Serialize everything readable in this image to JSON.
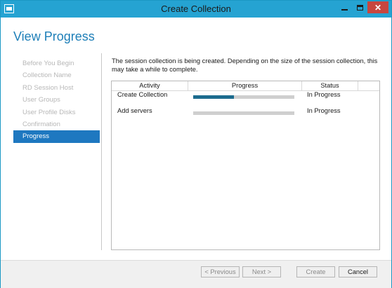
{
  "window": {
    "title": "Create Collection"
  },
  "page": {
    "heading": "View Progress"
  },
  "nav": {
    "items": [
      {
        "label": "Before You Begin",
        "active": false
      },
      {
        "label": "Collection Name",
        "active": false
      },
      {
        "label": "RD Session Host",
        "active": false
      },
      {
        "label": "User Groups",
        "active": false
      },
      {
        "label": "User Profile Disks",
        "active": false
      },
      {
        "label": "Confirmation",
        "active": false
      },
      {
        "label": "Progress",
        "active": true
      }
    ]
  },
  "content": {
    "description": "The session collection is being created. Depending on the size of the session collection, this may take a while to complete."
  },
  "table": {
    "headers": {
      "activity": "Activity",
      "progress": "Progress",
      "status": "Status"
    },
    "rows": [
      {
        "activity": "Create Collection",
        "progress": 0.4,
        "status": "In Progress"
      },
      {
        "activity": "Add servers",
        "progress": 0.0,
        "status": "In Progress"
      }
    ]
  },
  "footer": {
    "previous_label": "< Previous",
    "next_label": "Next >",
    "create_label": "Create",
    "cancel_label": "Cancel"
  },
  "colors": {
    "titlebar": "#25a3d2",
    "accent": "#1e78c0",
    "progress_fill": "#1c6b8e",
    "close_button": "#c7463f"
  }
}
